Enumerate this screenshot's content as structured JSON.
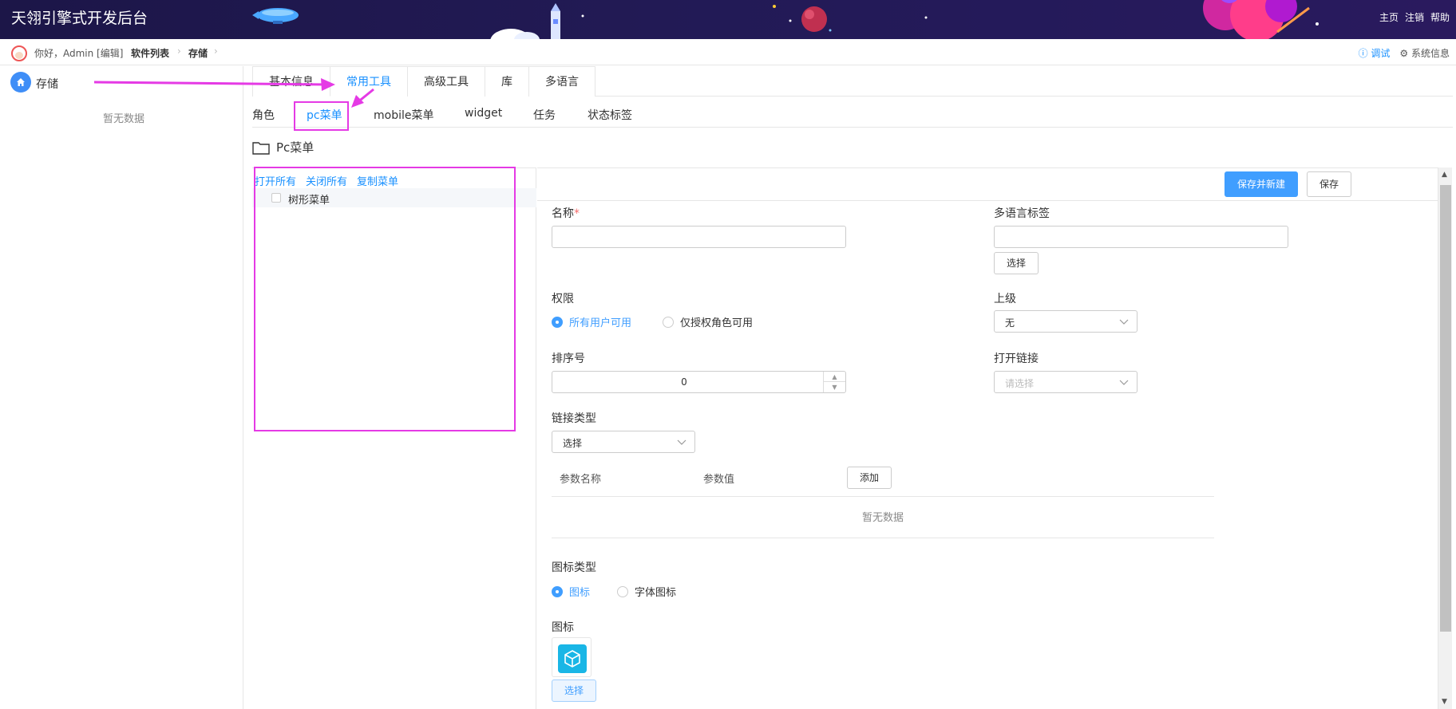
{
  "header": {
    "title": "天翎引擎式开发后台",
    "links": [
      "主页",
      "注销",
      "帮助"
    ],
    "bg_color": "#1c1648"
  },
  "breadcrumb": {
    "greeting": "你好，Admin [编辑]",
    "items": [
      "软件列表",
      "存储"
    ],
    "debug_label": "调试",
    "system_label": "系统信息"
  },
  "sidebar": {
    "store_label": "存储",
    "empty_text": "暂无数据"
  },
  "tabs": [
    "基本信息",
    "常用工具",
    "高级工具",
    "库",
    "多语言"
  ],
  "active_tab": "常用工具",
  "subtabs": [
    "角色",
    "pc菜单",
    "mobile菜单",
    "widget",
    "任务",
    "状态标签"
  ],
  "active_subtab": "pc菜单",
  "section_title": "Pc菜单",
  "tree": {
    "actions": [
      "打开所有",
      "关闭所有",
      "复制菜单"
    ],
    "node_label": "树形菜单"
  },
  "form": {
    "save_new_label": "保存并新建",
    "save_label": "保存",
    "name_label": "名称",
    "name_required": "*",
    "i18n_label": "多语言标签",
    "choose_label": "选择",
    "perm_label": "权限",
    "perm_options": [
      "所有用户可用",
      "仅授权角色可用"
    ],
    "parent_label": "上级",
    "parent_value": "无",
    "order_label": "排序号",
    "order_value": "0",
    "open_link_label": "打开链接",
    "open_link_placeholder": "请选择",
    "link_type_label": "链接类型",
    "link_type_value": "选择",
    "param_name_header": "参数名称",
    "param_value_header": "参数值",
    "add_label": "添加",
    "param_empty": "暂无数据",
    "icon_type_label": "图标类型",
    "icon_type_options": [
      "图标",
      "字体图标"
    ],
    "icon_label": "图标",
    "icon_choose_label": "选择"
  },
  "colors": {
    "accent": "#409eff",
    "annotation": "#e53ae5"
  }
}
